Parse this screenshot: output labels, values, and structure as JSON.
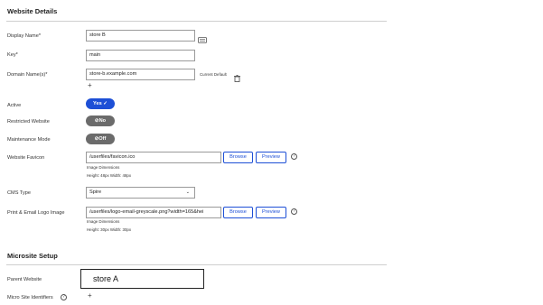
{
  "website_details": {
    "title": "Website Details",
    "display_name": {
      "label": "Display Name",
      "required_mark": "*",
      "value": "store B"
    },
    "key": {
      "label": "Key",
      "required_mark": "*",
      "value": "main"
    },
    "domain_names": {
      "label": "Domain Name(s)",
      "required_mark": "*",
      "value": "store-b.example.com",
      "current_default": "Current Default",
      "add": "+"
    },
    "active": {
      "label": "Active",
      "toggle": "Yes",
      "state_icon": "check-icon"
    },
    "restricted_website": {
      "label": "Restricted Website",
      "toggle": "No",
      "state_icon": "circle-off-icon"
    },
    "maintenance_mode": {
      "label": "Maintenance Mode",
      "toggle": "Off",
      "state_icon": "circle-off-icon"
    },
    "website_favicon": {
      "label": "Website Favicon",
      "value": "/userfiles/favicon.ico",
      "browse": "Browse",
      "preview": "Preview",
      "dims_title": "Image Dimensions",
      "dims": "Height: 48px  Width: 48px"
    },
    "cms_type": {
      "label": "CMS Type",
      "value": "Spire"
    },
    "print_email_logo": {
      "label": "Print & Email Logo Image",
      "value": "/userfiles/logo-email-greyscale.png?width=165&hei",
      "browse": "Browse",
      "preview": "Preview",
      "dims_title": "Image Dimensions",
      "dims": "Height: 30px  Width: 30px"
    }
  },
  "microsite_setup": {
    "title": "Microsite Setup",
    "parent_website": {
      "label": "Parent Website",
      "value": "store A"
    },
    "micro_site_identifiers": {
      "label": "Micro Site Identifiers",
      "add": "+"
    }
  },
  "colors": {
    "accent": "#1d4fd6",
    "toggle_off": "#6b6b6b",
    "divider": "#cfcfcf"
  }
}
